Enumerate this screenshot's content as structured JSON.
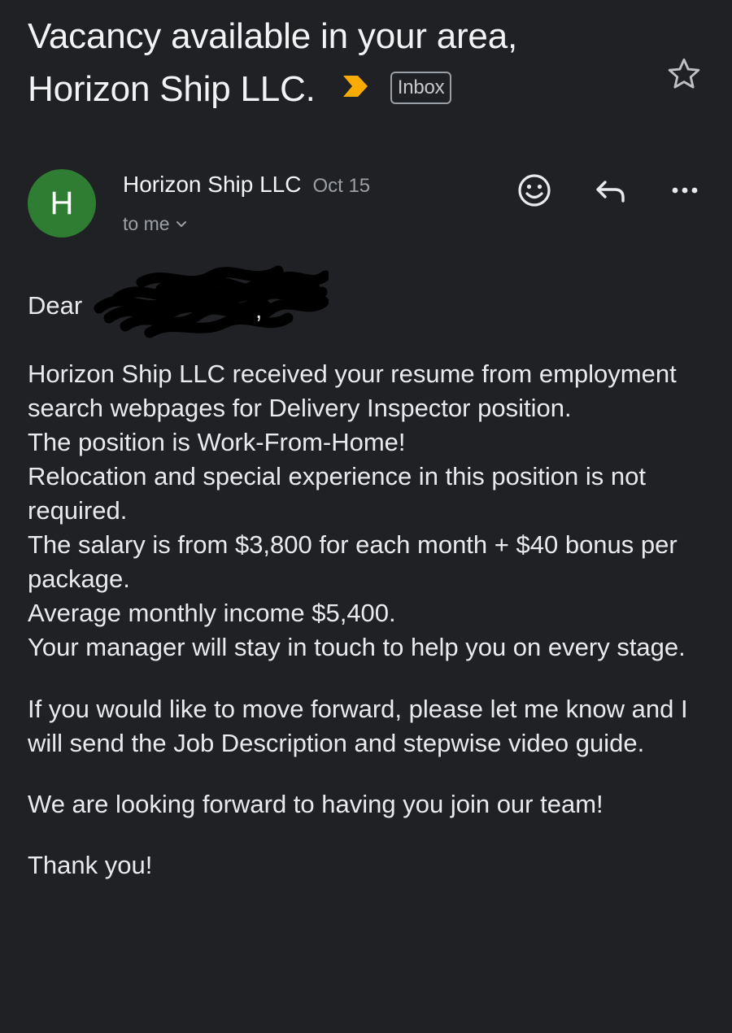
{
  "email": {
    "subject_line1": "Vacancy available in your area,",
    "subject_line2": "Horizon Ship LLC.",
    "label": "Inbox",
    "sender_initial": "H",
    "sender_name": "Horizon Ship LLC",
    "date": "Oct 15",
    "recipient": "to me",
    "greeting": "Dear",
    "greeting_end": ",",
    "body_lines": [
      "Horizon Ship LLC received your resume from employment search webpages for Delivery Inspector position.",
      "The position is Work-From-Home!",
      "Relocation and special experience in this position is not required.",
      "The salary is from $3,800 for each month + $40 bonus per package.",
      "Average monthly income $5,400.",
      "Your manager will stay in touch to help you on every stage."
    ],
    "paragraph_2": "If you would like to move forward, please let me know and I will send the Job Description and stepwise video guide.",
    "paragraph_3": "We are looking forward to having you join our team!",
    "closing": "Thank you!"
  },
  "icons": {
    "importance": "importance-marker-icon",
    "star": "star-icon",
    "recipient_expand": "chevron-down-icon",
    "emoji": "emoji-reaction-icon",
    "reply": "reply-icon",
    "more": "more-options-icon"
  },
  "colors": {
    "background": "#202124",
    "avatar": "#2e7d32",
    "importance": "#f9ab00",
    "text": "#e8eaed",
    "muted": "#9aa0a6"
  }
}
